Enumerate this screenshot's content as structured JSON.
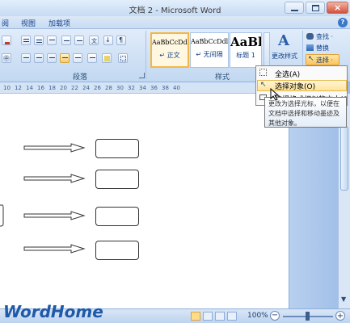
{
  "window": {
    "title": "文档 2 - Microsoft Word"
  },
  "menu": {
    "items": [
      "阅",
      "视图",
      "加载项"
    ]
  },
  "ribbon": {
    "groups": {
      "paragraph": "段落",
      "styles": "样式"
    },
    "styles": [
      {
        "sample": "AaBbCcDdl",
        "name": "↵ 正文"
      },
      {
        "sample": "AaBbCcDdl",
        "name": "↵ 无间隔"
      },
      {
        "sample": "AaBl",
        "name": "标题 1"
      }
    ],
    "change_styles": "更改样式",
    "editing": {
      "find": "查找 ·",
      "replace": "替换",
      "select": "选择 ·"
    }
  },
  "ruler": {
    "numbers": [
      "10",
      "12",
      "14",
      "16",
      "18",
      "20",
      "22",
      "24",
      "26",
      "28",
      "30",
      "32",
      "34",
      "36",
      "38",
      "40"
    ]
  },
  "select_menu": {
    "items": [
      {
        "label": "全选(A)"
      },
      {
        "label": "选择对象(O)"
      },
      {
        "label": "选择格式相似的文本(S)"
      }
    ]
  },
  "tooltip": {
    "text": "更改为选择光标，以便在文档中选择和移动墨迹及其他对象。"
  },
  "status": {
    "zoom": "100%"
  },
  "watermark": "WordHome"
}
